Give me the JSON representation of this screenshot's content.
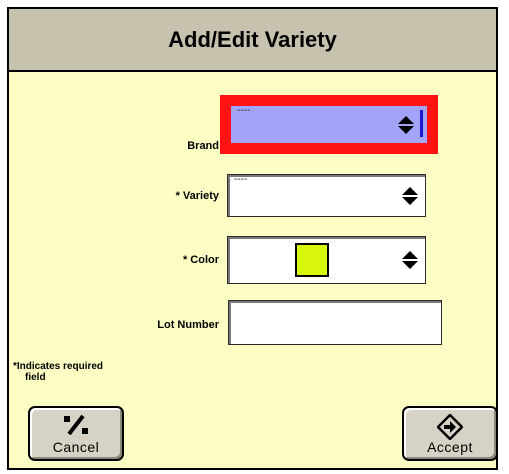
{
  "dialog": {
    "title": "Add/Edit Variety"
  },
  "fields": {
    "brand": {
      "label": "Brand",
      "value": "----",
      "focused": true
    },
    "variety": {
      "label": "* Variety",
      "value": "----"
    },
    "color": {
      "label": "* Color",
      "swatch_color": "#d8f50c"
    },
    "lot_number": {
      "label": "Lot Number",
      "value": ""
    }
  },
  "note": {
    "line1": "*Indicates required",
    "line2": "field"
  },
  "buttons": {
    "cancel": {
      "label": "Cancel",
      "icon": "cancel-slash-icon"
    },
    "accept": {
      "label": "Accept",
      "icon": "accept-arrow-icon"
    }
  },
  "colors": {
    "dialog_bg": "#fdfec4",
    "titlebar_bg": "#c7c2ae",
    "focus_outline": "#ff1313",
    "focused_field_bg": "#a3a3fa"
  }
}
